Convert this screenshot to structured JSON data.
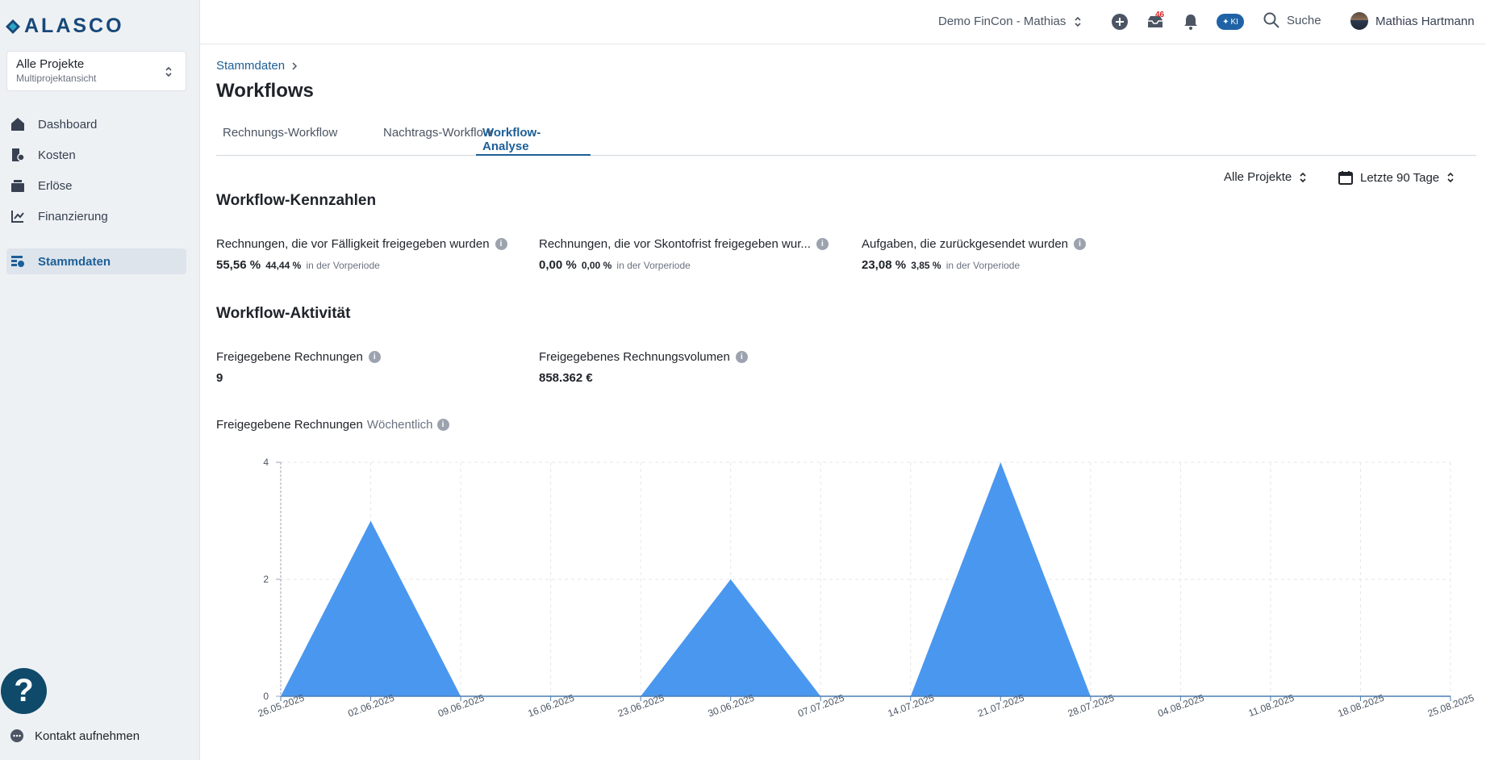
{
  "brand": {
    "name": "ALASCO"
  },
  "project_selector": {
    "title": "Alle Projekte",
    "subtitle": "Multiprojektansicht"
  },
  "sidebar": {
    "items": [
      {
        "label": "Dashboard",
        "icon": "home-icon"
      },
      {
        "label": "Kosten",
        "icon": "cost-icon"
      },
      {
        "label": "Erlöse",
        "icon": "revenue-icon"
      },
      {
        "label": "Finanzierung",
        "icon": "financing-icon"
      },
      {
        "label": "Stammdaten",
        "icon": "master-data-icon",
        "active": true
      }
    ],
    "contact_label": "Kontakt aufnehmen",
    "help_label": "?"
  },
  "header": {
    "tenant": "Demo FinCon - Mathias",
    "inbox_count": "46",
    "ki_label": "KI",
    "search_label": "Suche",
    "user_name": "Mathias Hartmann"
  },
  "breadcrumb": {
    "label": "Stammdaten"
  },
  "page": {
    "title": "Workflows"
  },
  "tabs": [
    {
      "label": "Rechnungs-Workflow"
    },
    {
      "label": "Nachtrags-Workflow"
    },
    {
      "label": "Workflow-Analyse",
      "active": true
    }
  ],
  "filters": {
    "project": "Alle Projekte",
    "period": "Letzte 90 Tage"
  },
  "kennzahlen": {
    "title": "Workflow-Kennzahlen",
    "items": [
      {
        "label": "Rechnungen, die vor Fälligkeit freigegeben wurden",
        "value": "55,56 %",
        "previous": "44,44 %",
        "previous_note": "in der Vorperiode"
      },
      {
        "label": "Rechnungen, die vor Skontofrist freigegeben wur...",
        "value": "0,00 %",
        "previous": "0,00 %",
        "previous_note": "in der Vorperiode"
      },
      {
        "label": "Aufgaben, die zurückgesendet wurden",
        "value": "23,08 %",
        "previous": "3,85 %",
        "previous_note": "in der Vorperiode"
      }
    ]
  },
  "aktivitaet": {
    "title": "Workflow-Aktivität",
    "items": [
      {
        "label": "Freigegebene Rechnungen",
        "value": "9"
      },
      {
        "label": "Freigegebenes Rechnungsvolumen",
        "value": "858.362 €"
      }
    ]
  },
  "chart_title": {
    "label": "Freigegebene Rechnungen",
    "granularity": "Wöchentlich"
  },
  "chart_data": {
    "type": "area",
    "title": "Freigegebene Rechnungen",
    "x": [
      "26.05.2025",
      "02.06.2025",
      "09.06.2025",
      "16.06.2025",
      "23.06.2025",
      "30.06.2025",
      "07.07.2025",
      "14.07.2025",
      "21.07.2025",
      "28.07.2025",
      "04.08.2025",
      "11.08.2025",
      "18.08.2025",
      "25.08.2025"
    ],
    "series": [
      {
        "values": [
          0,
          3,
          0,
          0,
          0,
          2,
          0,
          0,
          4,
          0,
          0,
          0,
          0,
          0
        ],
        "color": "#4a97ef"
      }
    ],
    "yticks": [
      "0",
      "2",
      "4"
    ],
    "ylim": [
      0,
      4
    ],
    "grid": true
  },
  "colors": {
    "accent": "#1d5f98",
    "area_fill": "#4a97ef",
    "sidebar_bg": "#eef1f4"
  }
}
